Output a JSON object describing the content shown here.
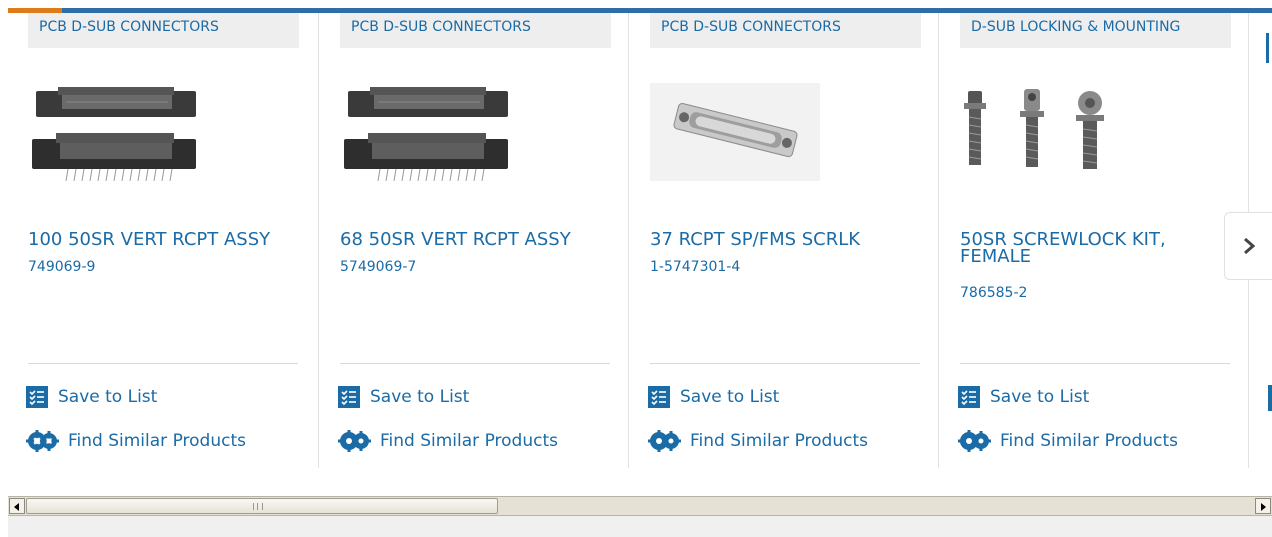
{
  "accent_colors": {
    "link": "#1a6ba6",
    "bar": "#2d6ea8",
    "bar_accent": "#e07b1a",
    "tag_bg": "#eeeeee"
  },
  "cards": [
    {
      "category": "PCB D-SUB CONNECTORS",
      "title": "100 50SR VERT RCPT ASSY",
      "part_number": "749069-9",
      "image": "d-sub-connector-pair-image"
    },
    {
      "category": "PCB D-SUB CONNECTORS",
      "title": "68 50SR VERT RCPT ASSY",
      "part_number": "5749069-7",
      "image": "d-sub-connector-pair-image"
    },
    {
      "category": "PCB D-SUB CONNECTORS",
      "title": "37 RCPT SP/FMS SCRLK",
      "part_number": "1-5747301-4",
      "image": "d-sub-receptacle-image"
    },
    {
      "category": "D-SUB LOCKING & MOUNTING",
      "title": "50SR SCREWLOCK KIT, FEMALE",
      "part_number": "786585-2",
      "image": "screwlock-kit-image"
    }
  ],
  "actions": {
    "save_label": "Save to List",
    "similar_label": "Find Similar Products"
  },
  "icons": {
    "save": "checklist-icon",
    "similar": "gears-icon",
    "next": "chevron-right-icon"
  }
}
